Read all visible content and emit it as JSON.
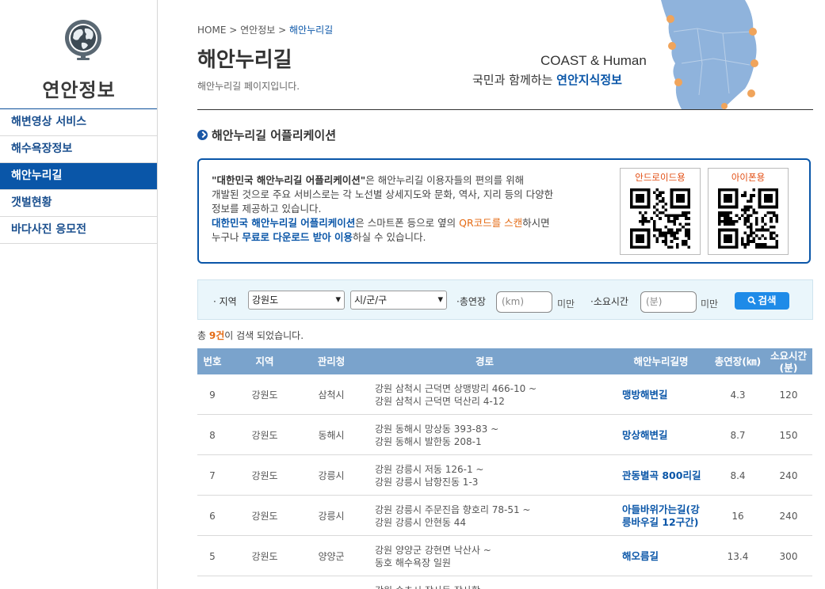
{
  "sidebar": {
    "title": "연안정보",
    "items": [
      {
        "label": "해변영상 서비스"
      },
      {
        "label": "해수욕장정보"
      },
      {
        "label": "해안누리길"
      },
      {
        "label": "갯벌현황"
      },
      {
        "label": "바다사진 응모전"
      }
    ],
    "active_index": 2
  },
  "header": {
    "breadcrumb": {
      "home": "HOME",
      "sep": ">",
      "level1": "연안정보",
      "current": "해안누리길"
    },
    "title": "해안누리길",
    "description": "해안누리길 페이지입니다.",
    "brand_line1": "COAST & Human",
    "brand_line2_a": "국민과 함께하는 ",
    "brand_line2_b": "연안지식정보"
  },
  "app_section": {
    "title": "해안누리길 어플리케이션",
    "p1_bold": "\"대한민국 해안누리길 어플리케이션\"",
    "p1_rest": "은 해안누리길 이용자들의 편의를 위해",
    "p2": "개발된 것으로 주요 서비스로는 각 노선별 상세지도와 문화, 역사, 지리 등의 다양한",
    "p3": "정보를 제공하고 있습니다.",
    "p4_blue": "대한민국 해안누리길 어플리케이션",
    "p4_mid": "은 스마트폰 등으로 옆의 ",
    "p4_orange": "QR코드를 스캔",
    "p4_end": "하시면",
    "p5_a": "누구나 ",
    "p5_blue": "무료로 다운로드 받아 이용",
    "p5_end": "하실 수 있습니다.",
    "qr_android": "안드로이드용",
    "qr_iphone": "아이폰용"
  },
  "search": {
    "region_label": "· 지역",
    "region_value": "강원도",
    "city_value": "시/군/구",
    "length_label": "·총연장",
    "length_placeholder": "(km)",
    "length_unit": "미만",
    "time_label": "·소요시간",
    "time_placeholder": "(분)",
    "time_unit": "미만",
    "button_label": "검색"
  },
  "results": {
    "prefix": "총 ",
    "count": "9건",
    "suffix": "이 검색 되었습니다."
  },
  "table": {
    "headers": {
      "no": "번호",
      "region": "지역",
      "office": "관리청",
      "route": "경로",
      "name": "해안누리길명",
      "length": "총연장(㎞)",
      "time": "소요시간(분)"
    },
    "rows": [
      {
        "no": "9",
        "region": "강원도",
        "office": "삼척시",
        "route1": "강원 삼척시 근덕면 상맹방리 466-10 ~",
        "route2": "강원 삼척시 근덕면 덕산리 4-12",
        "name1": "맹방해변길",
        "name2": "",
        "length": "4.3",
        "time": "120"
      },
      {
        "no": "8",
        "region": "강원도",
        "office": "동해시",
        "route1": "강원 동해시 망상동 393-83 ~",
        "route2": "강원 동해시 발한동 208-1",
        "name1": "망상해변길",
        "name2": "",
        "length": "8.7",
        "time": "150"
      },
      {
        "no": "7",
        "region": "강원도",
        "office": "강릉시",
        "route1": "강원 강릉시 저동 126-1 ~",
        "route2": "강원 강릉시 남항진동 1-3",
        "name1": "관동별곡 800리길",
        "name2": "",
        "length": "8.4",
        "time": "240"
      },
      {
        "no": "6",
        "region": "강원도",
        "office": "강릉시",
        "route1": "강원 강릉시 주문진읍 향호리 78-51 ~",
        "route2": "강원 강릉시 안현동 44",
        "name1": "아들바위가는길(강",
        "name2": "릉바우길 12구간)",
        "length": "16",
        "time": "240"
      },
      {
        "no": "5",
        "region": "강원도",
        "office": "양양군",
        "route1": "강원 양양군 강현면 낙산사 ~",
        "route2": "동호 해수욕장 일원",
        "name1": "해오름길",
        "name2": "",
        "length": "13.4",
        "time": "300"
      },
      {
        "no": "",
        "region": "",
        "office": "",
        "route1": "강원 속초시 장사동 장사항",
        "route2": "",
        "name1": "",
        "name2": "",
        "length": "",
        "time": ""
      }
    ]
  }
}
